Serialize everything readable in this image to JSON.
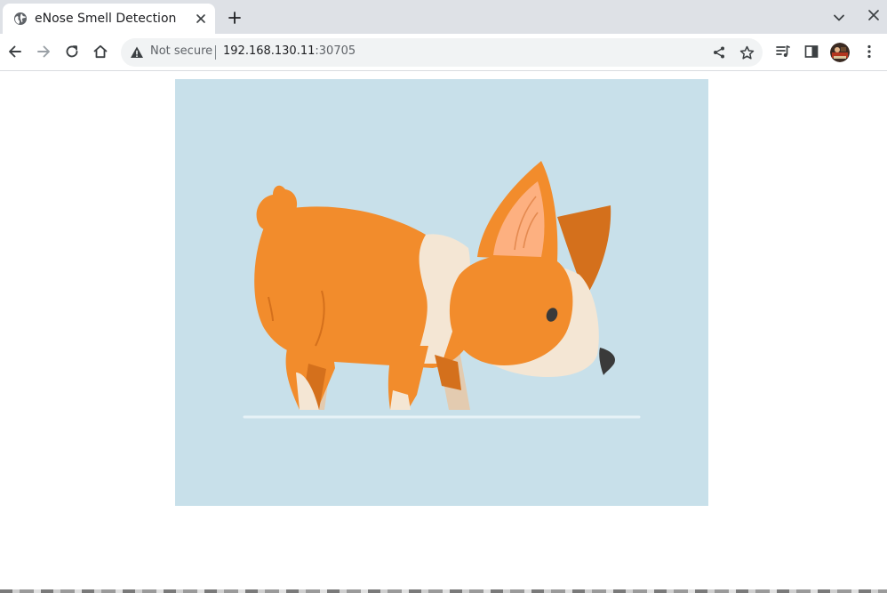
{
  "browser": {
    "tab": {
      "title": "eNose Smell Detection",
      "favicon": "globe-icon"
    },
    "toolbar": {
      "security_label": "Not secure",
      "url_host": "192.168.130.11",
      "url_port": ":30705"
    },
    "icons": {
      "back": "arrow-left-icon",
      "forward": "arrow-right-icon",
      "reload": "reload-icon",
      "home": "home-icon",
      "share": "share-icon",
      "bookmark": "star-icon",
      "media": "media-queue-icon",
      "side_panel": "side-panel-icon",
      "profile": "avatar"
    }
  },
  "colors": {
    "tabstrip_bg": "#dee1e6",
    "omnibox_bg": "#f1f3f4",
    "hero_bg": "#c8e0ea",
    "corgi_orange": "#f28c2c",
    "corgi_dark_orange": "#d4701c",
    "corgi_cream": "#f4e6d4",
    "corgi_ear_inner": "#fdb080"
  },
  "page": {
    "hero_image": "corgi-illustration"
  }
}
